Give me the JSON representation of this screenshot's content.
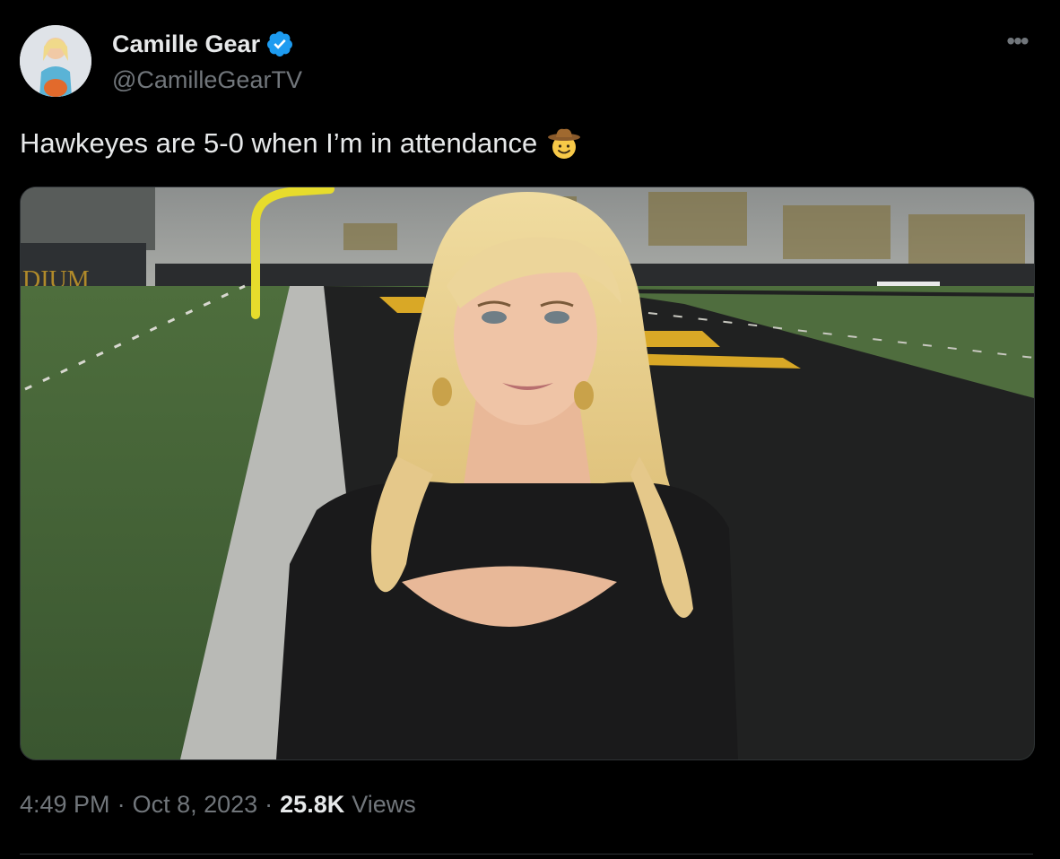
{
  "author": {
    "display_name": "Camille Gear",
    "handle": "@CamilleGearTV",
    "verified": true,
    "avatar_icon": "profile-photo"
  },
  "more_label": "•••",
  "tweet": {
    "text": "Hawkeyes are 5-0 when I’m in attendance",
    "emoji_icon": "cowboy-hat-face-emoji"
  },
  "media": {
    "stadium_sign": "DIUM"
  },
  "meta": {
    "time": "4:49 PM",
    "separator": "·",
    "date": "Oct 8, 2023",
    "views_count": "25.8K",
    "views_label": "Views"
  },
  "colors": {
    "background": "#000000",
    "text_primary": "#e7e9ea",
    "text_secondary": "#71767b",
    "verified_blue": "#1d9bf0",
    "divider": "#2f3336"
  }
}
